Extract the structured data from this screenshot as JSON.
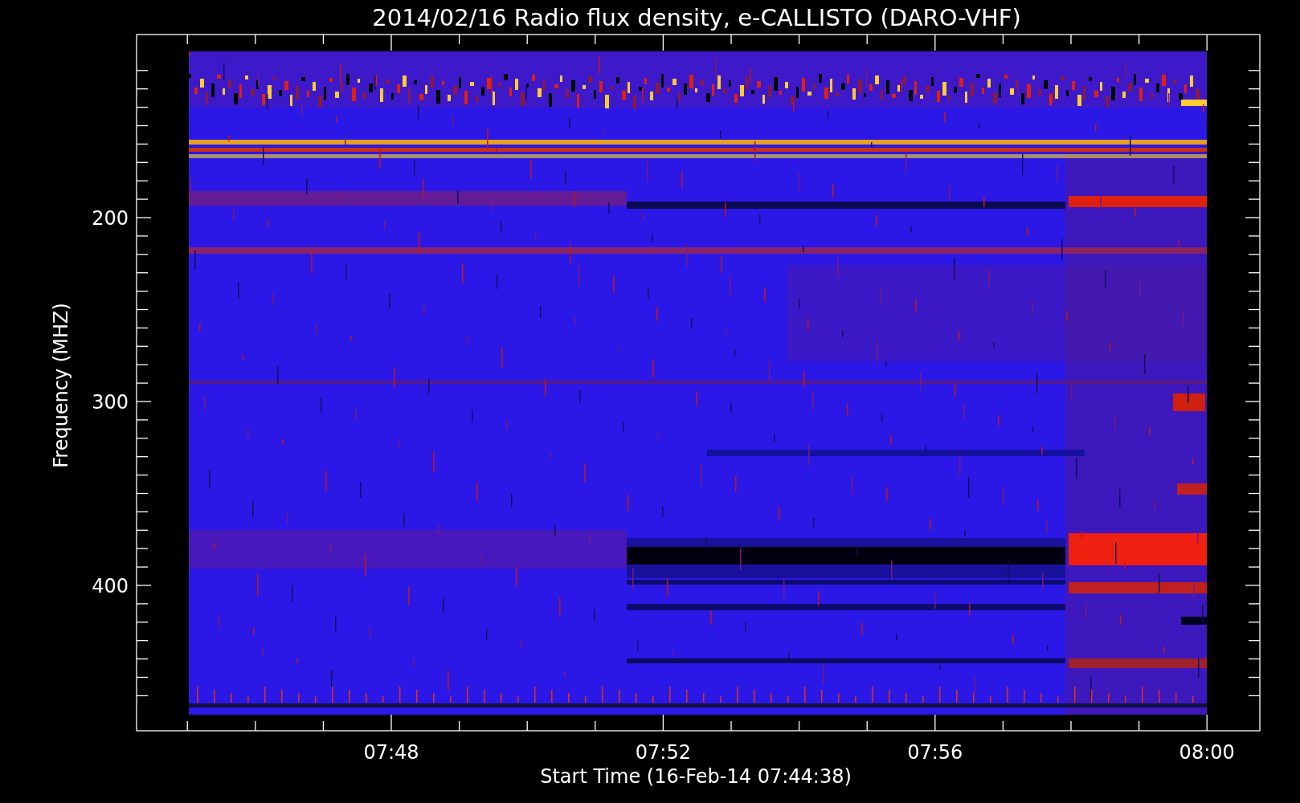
{
  "title": "2014/02/16  Radio flux density, e-CALLISTO (DARO-VHF)",
  "plot": {
    "y_axis": {
      "label": "Frequency (MHZ)",
      "ticks": [
        "200",
        "300",
        "400"
      ]
    },
    "x_axis": {
      "label": "Start Time (16-Feb-14 07:44:38)",
      "ticks": [
        "07:48",
        "07:52",
        "07:56",
        "08:00"
      ]
    }
  }
}
